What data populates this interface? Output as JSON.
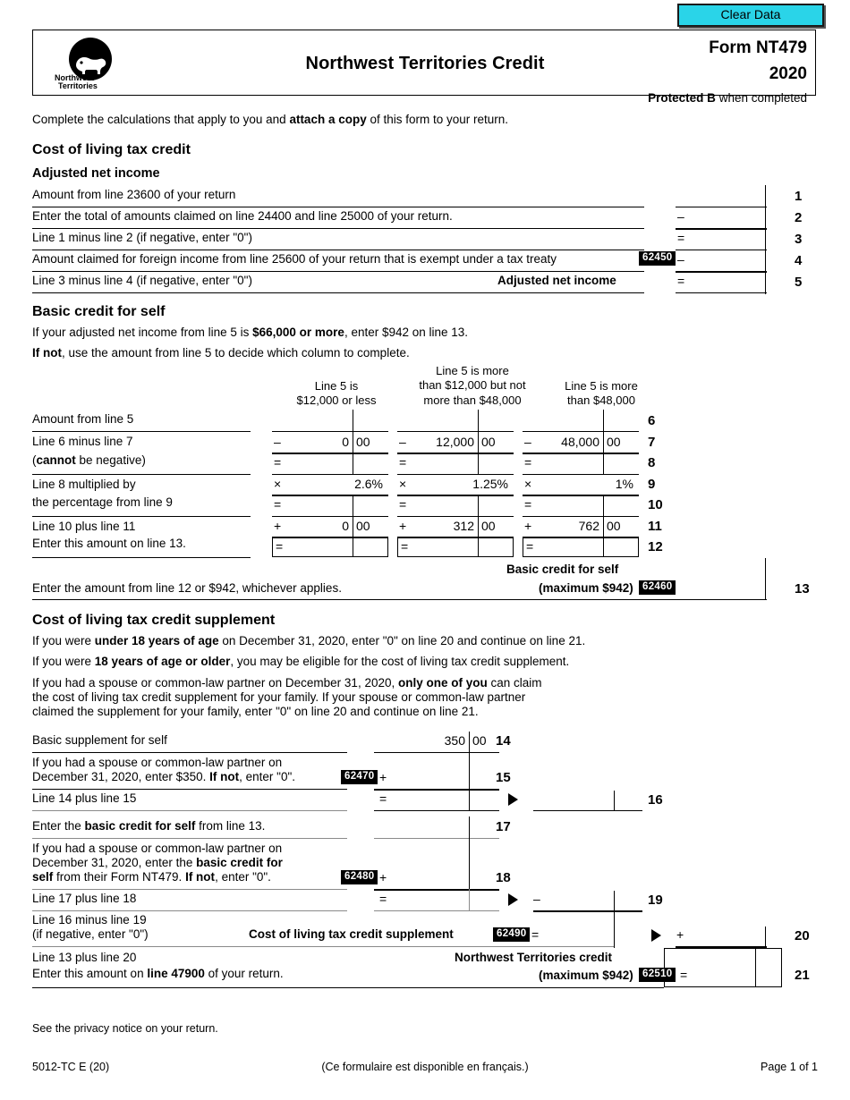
{
  "toolbar": {
    "clear_data_label": "Clear Data"
  },
  "header": {
    "title": "Northwest Territories Credit",
    "form_number": "Form NT479",
    "year": "2020",
    "protected_bold": "Protected B",
    "protected_rest": " when completed",
    "logo_line1": "Northwest",
    "logo_line2": "Territories"
  },
  "intro": {
    "part1": "Complete the calculations that apply to you and ",
    "bold": "attach a copy",
    "part2": " of this form to your return."
  },
  "sections": {
    "cost_of_living": "Cost of living tax credit",
    "adjusted_net_income": "Adjusted net income",
    "basic_credit_for_self": "Basic credit for self",
    "supplement": "Cost of living tax credit supplement"
  },
  "lines_1_5": [
    {
      "no": "1",
      "label": "Amount from line 23600 of your return",
      "op": ""
    },
    {
      "no": "2",
      "label": "Enter the total of amounts claimed on line 24400 and line 25000 of your return.",
      "op": "–"
    },
    {
      "no": "3",
      "label": "Line 1 minus line 2 (if negative, enter \"0\")",
      "op": "="
    },
    {
      "no": "4",
      "label": "Amount claimed for foreign income from line 25600 of your return that is exempt under a tax treaty",
      "op": "–",
      "code": "62450"
    },
    {
      "no": "5",
      "label": "Line 3 minus line 4 (if negative, enter \"0\")",
      "op": "=",
      "bold_label": "Adjusted net income"
    }
  ],
  "basic_credit": {
    "intro1_a": "If your adjusted net income from line 5 is ",
    "intro1_b": "$66,000 or more",
    "intro1_c": ", enter $942 on line 13.",
    "intro2_a": "If not",
    "intro2_b": ", use the amount from line 5 to decide which column to complete.",
    "columns": [
      {
        "head_lines": [
          "Line 5 is",
          "$12,000 or less"
        ]
      },
      {
        "head_lines": [
          "Line 5 is more",
          "than $12,000 but not",
          "more than $48,000"
        ]
      },
      {
        "head_lines": [
          "Line 5 is more",
          "than $48,000"
        ]
      }
    ],
    "rows": [
      {
        "no": "6",
        "label": "Amount from line 5",
        "ops": [
          "",
          "",
          ""
        ],
        "values": [
          "",
          "",
          ""
        ]
      },
      {
        "no": "7",
        "label_a": "Line 6 minus line 7",
        "ops": [
          "–",
          "–",
          "–"
        ],
        "values": [
          "0",
          "12,000",
          "48,000"
        ],
        "cents": [
          "00",
          "00",
          "00"
        ]
      },
      {
        "no": "8",
        "label_b": "(cannot be negative)",
        "ops": [
          "=",
          "=",
          "="
        ],
        "values": [
          "",
          "",
          ""
        ]
      },
      {
        "no": "9",
        "label_a": "Line 8 multiplied by",
        "ops": [
          "×",
          "×",
          "×"
        ],
        "values": [
          "2.6%",
          "1.25%",
          "1%"
        ]
      },
      {
        "no": "10",
        "label_b": "the percentage from line 9",
        "ops": [
          "=",
          "=",
          "="
        ],
        "values": [
          "",
          "",
          ""
        ]
      },
      {
        "no": "11",
        "label_a": "Line 10 plus line 11",
        "ops": [
          "+",
          "+",
          "+"
        ],
        "values": [
          "0",
          "312",
          "762"
        ],
        "cents": [
          "00",
          "00",
          "00"
        ]
      },
      {
        "no": "12",
        "label_b": "Enter this amount on line 13.",
        "ops": [
          "=",
          "=",
          "="
        ],
        "values": [
          "",
          "",
          ""
        ]
      }
    ],
    "row8_label_pre": "(",
    "row8_label_bold": "cannot",
    "row8_label_post": " be negative)"
  },
  "line13": {
    "no": "13",
    "label": "Enter the amount from line 12 or $942, whichever applies.",
    "title": "Basic credit for self",
    "maximum": "(maximum $942)",
    "code": "62460"
  },
  "supplement_text": {
    "p1_a": "If you were ",
    "p1_b": "under 18 years of age",
    "p1_c": " on December 31, 2020, enter \"0\" on line 20 and continue on line 21.",
    "p2_a": "If you were ",
    "p2_b": "18 years of age or older",
    "p2_c": ", you may be eligible for the cost of living tax credit supplement.",
    "p3_l1_a": "If you had a spouse or common-law partner on December 31, 2020, ",
    "p3_l1_b": "only one of you",
    "p3_l1_c": " can claim",
    "p3_l2": "the cost of living tax credit supplement for your family. If your spouse or common-law partner",
    "p3_l3": "claimed the supplement for your family, enter \"0\" on line 20 and continue on line 21."
  },
  "lines_14_21": {
    "l14": {
      "no": "14",
      "label": "Basic supplement for self",
      "value": "350",
      "cents": "00"
    },
    "l15": {
      "no": "15",
      "l1": "If you had a spouse or common-law partner on",
      "l2_a": "December 31, 2020, enter $350. ",
      "l2_b": "If not",
      "l2_c": ", enter \"0\".",
      "code": "62470",
      "op": "+"
    },
    "l16": {
      "no": "16",
      "label": "Line 14 plus line 15",
      "op": "="
    },
    "l17": {
      "no": "17",
      "label_a": "Enter the ",
      "label_b": "basic credit for self",
      "label_c": " from line 13."
    },
    "l18": {
      "no": "18",
      "l1": "If you had a spouse or common-law partner on",
      "l2_a": "December 31, 2020, enter the ",
      "l2_b": "basic credit for",
      "l3_a": "self",
      "l3_b": " from their Form NT479. ",
      "l3_c": "If not",
      "l3_d": ", enter \"0\".",
      "code": "62480",
      "op": "+"
    },
    "l19": {
      "no": "19",
      "label": "Line 17 plus line 18",
      "op": "=",
      "op2": "–"
    },
    "l20": {
      "no": "20",
      "l1": "Line 16 minus line 19",
      "l2": "(if negative, enter \"0\")",
      "title": "Cost of living tax credit supplement",
      "code": "62490",
      "op": "=",
      "op2": "+"
    },
    "l21": {
      "no": "21",
      "l1": "Line 13 plus line 20",
      "l2_a": "Enter this amount on ",
      "l2_b": "line 47900",
      "l2_c": " of your return.",
      "title": "Northwest Territories credit",
      "maximum": "(maximum $942)",
      "code": "62510",
      "op": "="
    }
  },
  "privacy": "See the privacy notice on your return.",
  "footer": {
    "left": "5012-TC E (20)",
    "center": "(Ce formulaire est disponible en français.)",
    "right": "Page 1 of 1"
  },
  "colors": {
    "clear_data_bg": "#2ad4e8",
    "code_bg": "#000000",
    "code_fg": "#ffffff"
  }
}
